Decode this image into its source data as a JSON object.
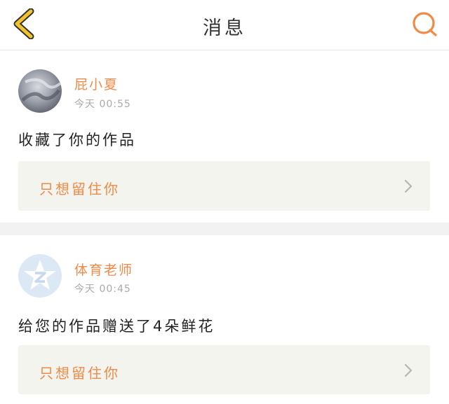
{
  "header": {
    "title": "消息"
  },
  "messages": [
    {
      "username": "屁小夏",
      "time": "今天 00:55",
      "text": "收藏了你的作品",
      "work_title": "只想留住你"
    },
    {
      "username": "体育老师",
      "time": "今天 00:45",
      "text": "给您的作品赠送了4朵鲜花",
      "work_title": "只想留住你"
    }
  ],
  "colors": {
    "accent": "#f08a48",
    "back_arrow": "#f2c32c",
    "link_bg": "#f4f4ee"
  }
}
